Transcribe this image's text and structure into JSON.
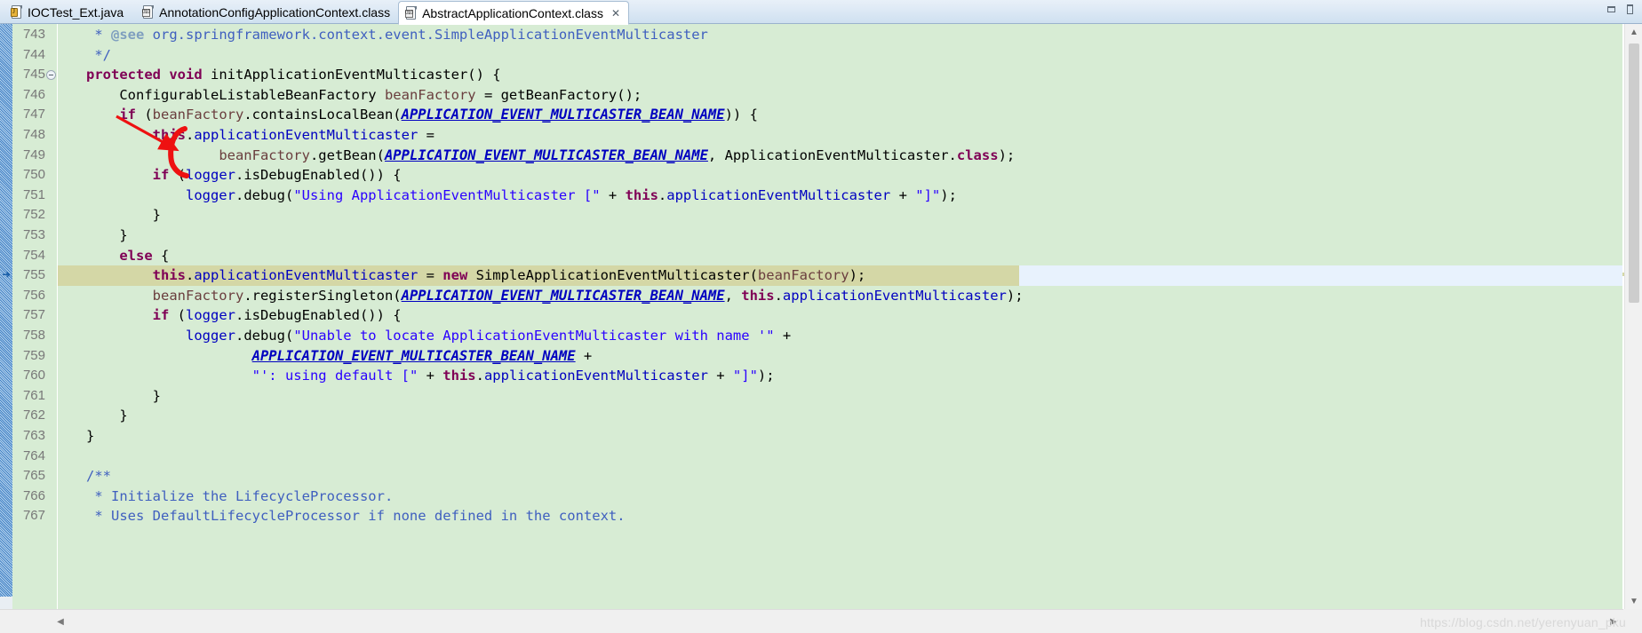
{
  "window": {
    "minimize_label": "▭",
    "maximize_label": "▯"
  },
  "tabs": [
    {
      "label": "IOCTest_Ext.java",
      "icon": "java-file-icon",
      "active": false,
      "closable": false
    },
    {
      "label": "AnnotationConfigApplicationContext.class",
      "icon": "class-file-icon",
      "active": false,
      "closable": false
    },
    {
      "label": "AbstractApplicationContext.class",
      "icon": "class-file-icon",
      "active": true,
      "closable": true,
      "close_label": "✕"
    }
  ],
  "editor": {
    "first_line": 743,
    "current_line": 755,
    "fold_line": 745,
    "marker_line": 755,
    "marker_glyph": "➜",
    "colors": {
      "background": "#d7ecd4",
      "gutter": "#d7ecd4",
      "current_line_highlight": "#e8f2fd",
      "selection_highlight": "#d4d7a6",
      "keyword": "#7f0055",
      "string": "#2a00ff",
      "field": "#0000c0",
      "local_var": "#6a3e3e",
      "javadoc": "#3f5fbf",
      "javadoc_tag": "#7f9fbf",
      "annotation_red": "#ee1111"
    },
    "lines": [
      {
        "n": 743,
        "tokens": [
          {
            "t": "    ",
            "c": "plain"
          },
          {
            "t": "* ",
            "c": "jdoc"
          },
          {
            "t": "@see",
            "c": "jtag"
          },
          {
            "t": " org.springframework.context.event.SimpleApplicationEventMulticaster",
            "c": "jdoc"
          }
        ]
      },
      {
        "n": 744,
        "tokens": [
          {
            "t": "    */",
            "c": "jdoc"
          }
        ]
      },
      {
        "n": 745,
        "tokens": [
          {
            "t": "   ",
            "c": "plain"
          },
          {
            "t": "protected",
            "c": "kw"
          },
          {
            "t": " ",
            "c": "plain"
          },
          {
            "t": "void",
            "c": "kw"
          },
          {
            "t": " initApplicationEventMulticaster() {",
            "c": "plain"
          }
        ]
      },
      {
        "n": 746,
        "tokens": [
          {
            "t": "       ConfigurableListableBeanFactory ",
            "c": "plain"
          },
          {
            "t": "beanFactory",
            "c": "loc"
          },
          {
            "t": " = getBeanFactory();",
            "c": "plain"
          }
        ]
      },
      {
        "n": 747,
        "tokens": [
          {
            "t": "       ",
            "c": "plain"
          },
          {
            "t": "if",
            "c": "kw"
          },
          {
            "t": " (",
            "c": "plain"
          },
          {
            "t": "beanFactory",
            "c": "loc"
          },
          {
            "t": ".containsLocalBean(",
            "c": "plain"
          },
          {
            "t": "APPLICATION_EVENT_MULTICASTER_BEAN_NAME",
            "c": "fldi"
          },
          {
            "t": ")) {",
            "c": "plain"
          }
        ]
      },
      {
        "n": 748,
        "tokens": [
          {
            "t": "           ",
            "c": "plain"
          },
          {
            "t": "this",
            "c": "this"
          },
          {
            "t": ".",
            "c": "plain"
          },
          {
            "t": "applicationEventMulticaster",
            "c": "fld"
          },
          {
            "t": " =",
            "c": "plain"
          }
        ]
      },
      {
        "n": 749,
        "tokens": [
          {
            "t": "                   ",
            "c": "plain"
          },
          {
            "t": "beanFactory",
            "c": "loc"
          },
          {
            "t": ".getBean(",
            "c": "plain"
          },
          {
            "t": "APPLICATION_EVENT_MULTICASTER_BEAN_NAME",
            "c": "fldi"
          },
          {
            "t": ", ApplicationEventMulticaster.",
            "c": "plain"
          },
          {
            "t": "class",
            "c": "kw"
          },
          {
            "t": ");",
            "c": "plain"
          }
        ]
      },
      {
        "n": 750,
        "tokens": [
          {
            "t": "           ",
            "c": "plain"
          },
          {
            "t": "if",
            "c": "kw"
          },
          {
            "t": " (",
            "c": "plain"
          },
          {
            "t": "logger",
            "c": "fld"
          },
          {
            "t": ".isDebugEnabled()) {",
            "c": "plain"
          }
        ]
      },
      {
        "n": 751,
        "tokens": [
          {
            "t": "               ",
            "c": "plain"
          },
          {
            "t": "logger",
            "c": "fld"
          },
          {
            "t": ".debug(",
            "c": "plain"
          },
          {
            "t": "\"Using ApplicationEventMulticaster [\"",
            "c": "str"
          },
          {
            "t": " + ",
            "c": "plain"
          },
          {
            "t": "this",
            "c": "this"
          },
          {
            "t": ".",
            "c": "plain"
          },
          {
            "t": "applicationEventMulticaster",
            "c": "fld"
          },
          {
            "t": " + ",
            "c": "plain"
          },
          {
            "t": "\"]\"",
            "c": "str"
          },
          {
            "t": ");",
            "c": "plain"
          }
        ]
      },
      {
        "n": 752,
        "tokens": [
          {
            "t": "           }",
            "c": "plain"
          }
        ]
      },
      {
        "n": 753,
        "tokens": [
          {
            "t": "       }",
            "c": "plain"
          }
        ]
      },
      {
        "n": 754,
        "tokens": [
          {
            "t": "       ",
            "c": "plain"
          },
          {
            "t": "else",
            "c": "kw"
          },
          {
            "t": " {",
            "c": "plain"
          }
        ]
      },
      {
        "n": 755,
        "tokens": [
          {
            "t": "           ",
            "c": "plain"
          },
          {
            "t": "this",
            "c": "this"
          },
          {
            "t": ".",
            "c": "plain"
          },
          {
            "t": "applicationEventMulticaster",
            "c": "fld"
          },
          {
            "t": " = ",
            "c": "plain"
          },
          {
            "t": "new",
            "c": "kw"
          },
          {
            "t": " SimpleApplicationEventMulticaster(",
            "c": "plain"
          },
          {
            "t": "beanFactory",
            "c": "loc"
          },
          {
            "t": ");",
            "c": "plain"
          }
        ]
      },
      {
        "n": 756,
        "tokens": [
          {
            "t": "           ",
            "c": "plain"
          },
          {
            "t": "beanFactory",
            "c": "loc"
          },
          {
            "t": ".registerSingleton(",
            "c": "plain"
          },
          {
            "t": "APPLICATION_EVENT_MULTICASTER_BEAN_NAME",
            "c": "fldi"
          },
          {
            "t": ", ",
            "c": "plain"
          },
          {
            "t": "this",
            "c": "this"
          },
          {
            "t": ".",
            "c": "plain"
          },
          {
            "t": "applicationEventMulticaster",
            "c": "fld"
          },
          {
            "t": ");",
            "c": "plain"
          }
        ]
      },
      {
        "n": 757,
        "tokens": [
          {
            "t": "           ",
            "c": "plain"
          },
          {
            "t": "if",
            "c": "kw"
          },
          {
            "t": " (",
            "c": "plain"
          },
          {
            "t": "logger",
            "c": "fld"
          },
          {
            "t": ".isDebugEnabled()) {",
            "c": "plain"
          }
        ]
      },
      {
        "n": 758,
        "tokens": [
          {
            "t": "               ",
            "c": "plain"
          },
          {
            "t": "logger",
            "c": "fld"
          },
          {
            "t": ".debug(",
            "c": "plain"
          },
          {
            "t": "\"Unable to locate ApplicationEventMulticaster with name '\"",
            "c": "str"
          },
          {
            "t": " +",
            "c": "plain"
          }
        ]
      },
      {
        "n": 759,
        "tokens": [
          {
            "t": "                       ",
            "c": "plain"
          },
          {
            "t": "APPLICATION_EVENT_MULTICASTER_BEAN_NAME",
            "c": "fldi"
          },
          {
            "t": " +",
            "c": "plain"
          }
        ]
      },
      {
        "n": 760,
        "tokens": [
          {
            "t": "                       ",
            "c": "plain"
          },
          {
            "t": "\"': using default [\"",
            "c": "str"
          },
          {
            "t": " + ",
            "c": "plain"
          },
          {
            "t": "this",
            "c": "this"
          },
          {
            "t": ".",
            "c": "plain"
          },
          {
            "t": "applicationEventMulticaster",
            "c": "fld"
          },
          {
            "t": " + ",
            "c": "plain"
          },
          {
            "t": "\"]\"",
            "c": "str"
          },
          {
            "t": ");",
            "c": "plain"
          }
        ]
      },
      {
        "n": 761,
        "tokens": [
          {
            "t": "           }",
            "c": "plain"
          }
        ]
      },
      {
        "n": 762,
        "tokens": [
          {
            "t": "       }",
            "c": "plain"
          }
        ]
      },
      {
        "n": 763,
        "tokens": [
          {
            "t": "   }",
            "c": "plain"
          }
        ]
      },
      {
        "n": 764,
        "tokens": [
          {
            "t": "",
            "c": "plain"
          }
        ]
      },
      {
        "n": 765,
        "tokens": [
          {
            "t": "   ",
            "c": "plain"
          },
          {
            "t": "/**",
            "c": "jdoc"
          }
        ]
      },
      {
        "n": 766,
        "tokens": [
          {
            "t": "    * Initialize the LifecycleProcessor.",
            "c": "jdoc"
          }
        ]
      },
      {
        "n": 767,
        "tokens": [
          {
            "t": "    * Uses DefaultLifecycleProcessor if none defined in the context.",
            "c": "jdoc"
          }
        ]
      }
    ]
  },
  "scrollbars": {
    "vertical": {
      "up_arrow": "▲",
      "down_arrow": "▼"
    },
    "horizontal": {
      "left_arrow": "◀",
      "right_arrow": "▶"
    }
  },
  "watermark": "https://blog.csdn.net/yerenyuan_pku"
}
